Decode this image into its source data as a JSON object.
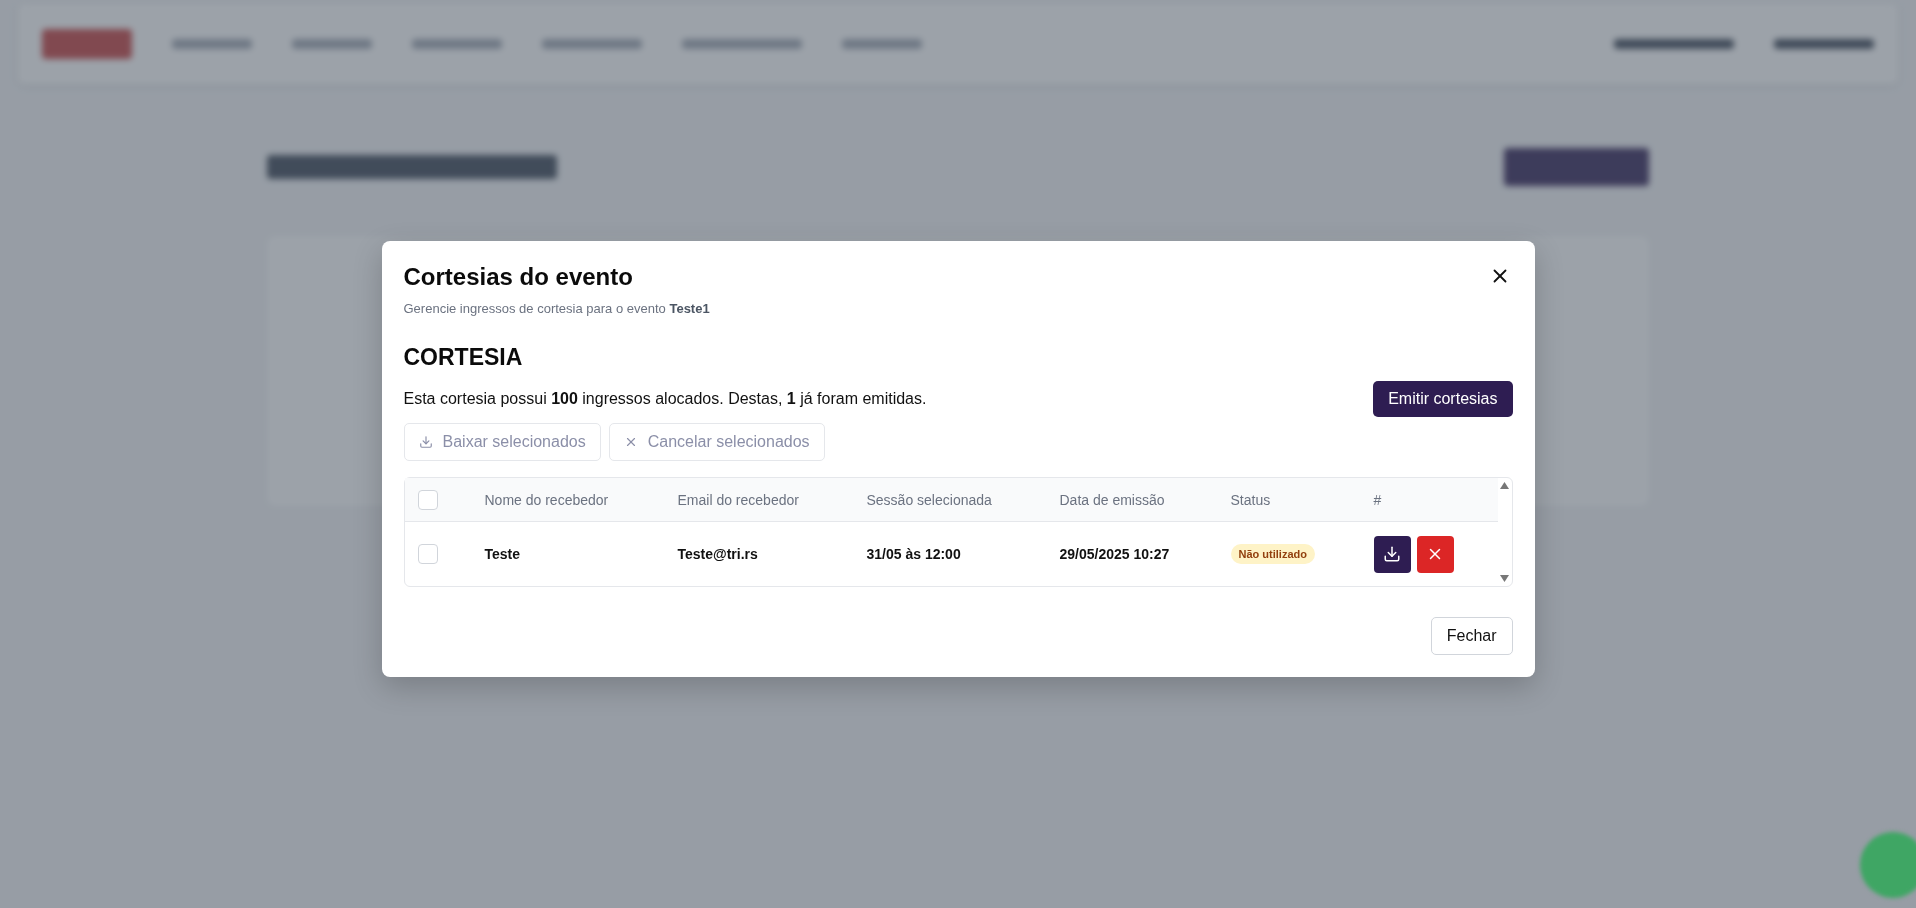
{
  "dialog": {
    "title": "Cortesias do evento",
    "subtitle": "Gerencie ingressos de cortesia para o evento **Teste1**",
    "section_title": "CORTESIA",
    "summary": "Esta cortesia possui **100** ingressos alocados. Destas, **1** já foram emitidas.",
    "primary_button": "Emitir cortesias",
    "bulk_actions": [
      {
        "kind": "download",
        "label": "Baixar selecionados",
        "disabled": true
      },
      {
        "kind": "cancel",
        "label": "Cancelar selecionados",
        "disabled": true
      }
    ],
    "table": {
      "select_all": {
        "checked": false
      },
      "columns": [
        "Nome do recebedor",
        "Email do recebedor",
        "Sessão selecionada",
        "Data de emissão",
        "Status",
        "#"
      ],
      "rows": [
        {
          "checked": false,
          "cells": [
            "Teste",
            "Teste@tri.rs",
            "31/05 às 12:00",
            "29/05/2025 10:27"
          ],
          "status": "Não utilizado"
        }
      ]
    },
    "footer_button": "Fechar"
  }
}
